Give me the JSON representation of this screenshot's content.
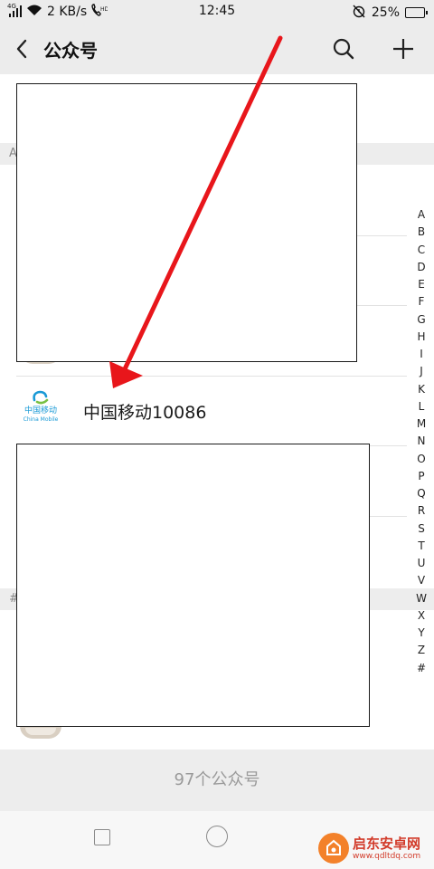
{
  "status_bar": {
    "network_type": "4G",
    "speed": "2 KB/s",
    "time": "12:45",
    "battery": "25%",
    "battery_level": 0.25,
    "icons": [
      "signal-icon",
      "wifi-icon",
      "hd-call-icon",
      "alarm-off-icon",
      "battery-icon"
    ]
  },
  "header": {
    "back_icon": "chevron-left-icon",
    "title": "公众号",
    "search_icon": "search-icon",
    "add_icon": "plus-icon"
  },
  "sections": [
    {
      "header": "A"
    },
    {
      "header": "#"
    }
  ],
  "accounts": [
    {
      "name": "中国移动10086",
      "logo_cn": "中国移动",
      "logo_en": "China Mobile"
    }
  ],
  "index_bar": [
    "A",
    "B",
    "C",
    "D",
    "E",
    "F",
    "G",
    "H",
    "I",
    "J",
    "K",
    "L",
    "M",
    "N",
    "O",
    "P",
    "Q",
    "R",
    "S",
    "T",
    "U",
    "V",
    "W",
    "X",
    "Y",
    "Z",
    "#"
  ],
  "footer": {
    "count_text": "97个公众号"
  },
  "system_nav": {
    "buttons": [
      "recent-apps-button",
      "home-button"
    ]
  },
  "watermark": {
    "name": "启东安卓网",
    "url": "www.qdltdq.com"
  },
  "colors": {
    "annotation_arrow": "#e8161b",
    "china_mobile_blue": "#1a9ad6",
    "battery_green": "#2fb72f",
    "header_bg": "#ececec"
  }
}
